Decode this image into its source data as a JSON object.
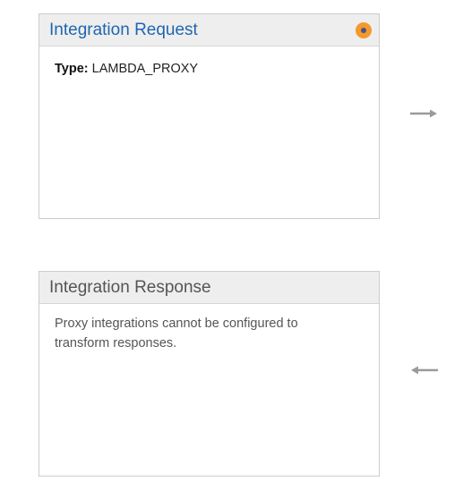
{
  "request": {
    "title": "Integration Request",
    "type_label": "Type:",
    "type_value": "LAMBDA_PROXY"
  },
  "response": {
    "title": "Integration Response",
    "message": "Proxy integrations cannot be configured to transform responses."
  },
  "icons": {
    "request_status": "status-dot-icon",
    "to_right": "arrow-right-icon",
    "to_left": "arrow-left-icon"
  },
  "colors": {
    "request_title": "#1f66b0",
    "response_title": "#555555",
    "status_outer": "#f39a2c",
    "status_inner": "#4d4f8a",
    "arrow": "#9a9a9a"
  }
}
